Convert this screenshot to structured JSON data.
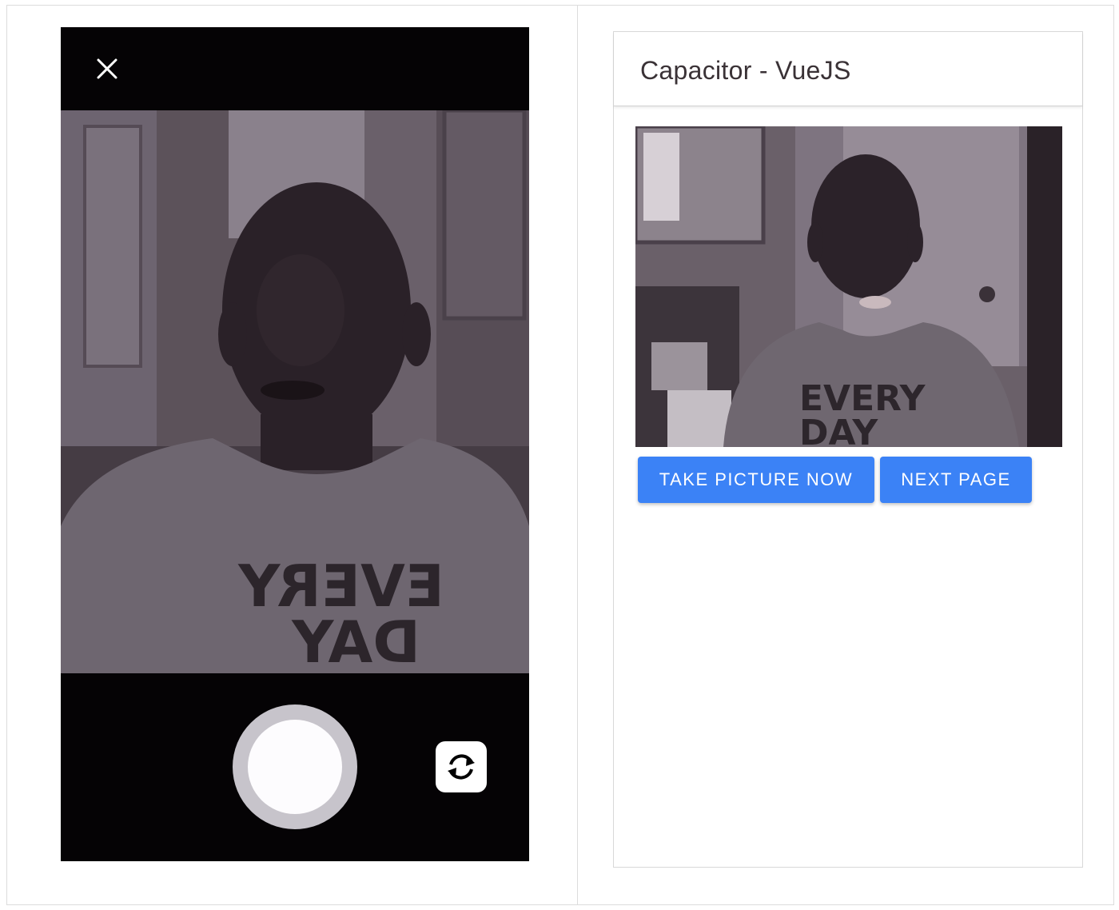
{
  "camera": {
    "close_icon": "close-icon",
    "flip_icon": "camera-flip-icon",
    "shirt_text_mirrored": "EVERY DAY"
  },
  "app": {
    "title": "Capacitor - VueJS",
    "take_picture_label": "TAKE PICTURE NOW",
    "next_page_label": "NEXT PAGE",
    "shirt_text": "EVERY DAY",
    "accent": "#3b82f6"
  }
}
